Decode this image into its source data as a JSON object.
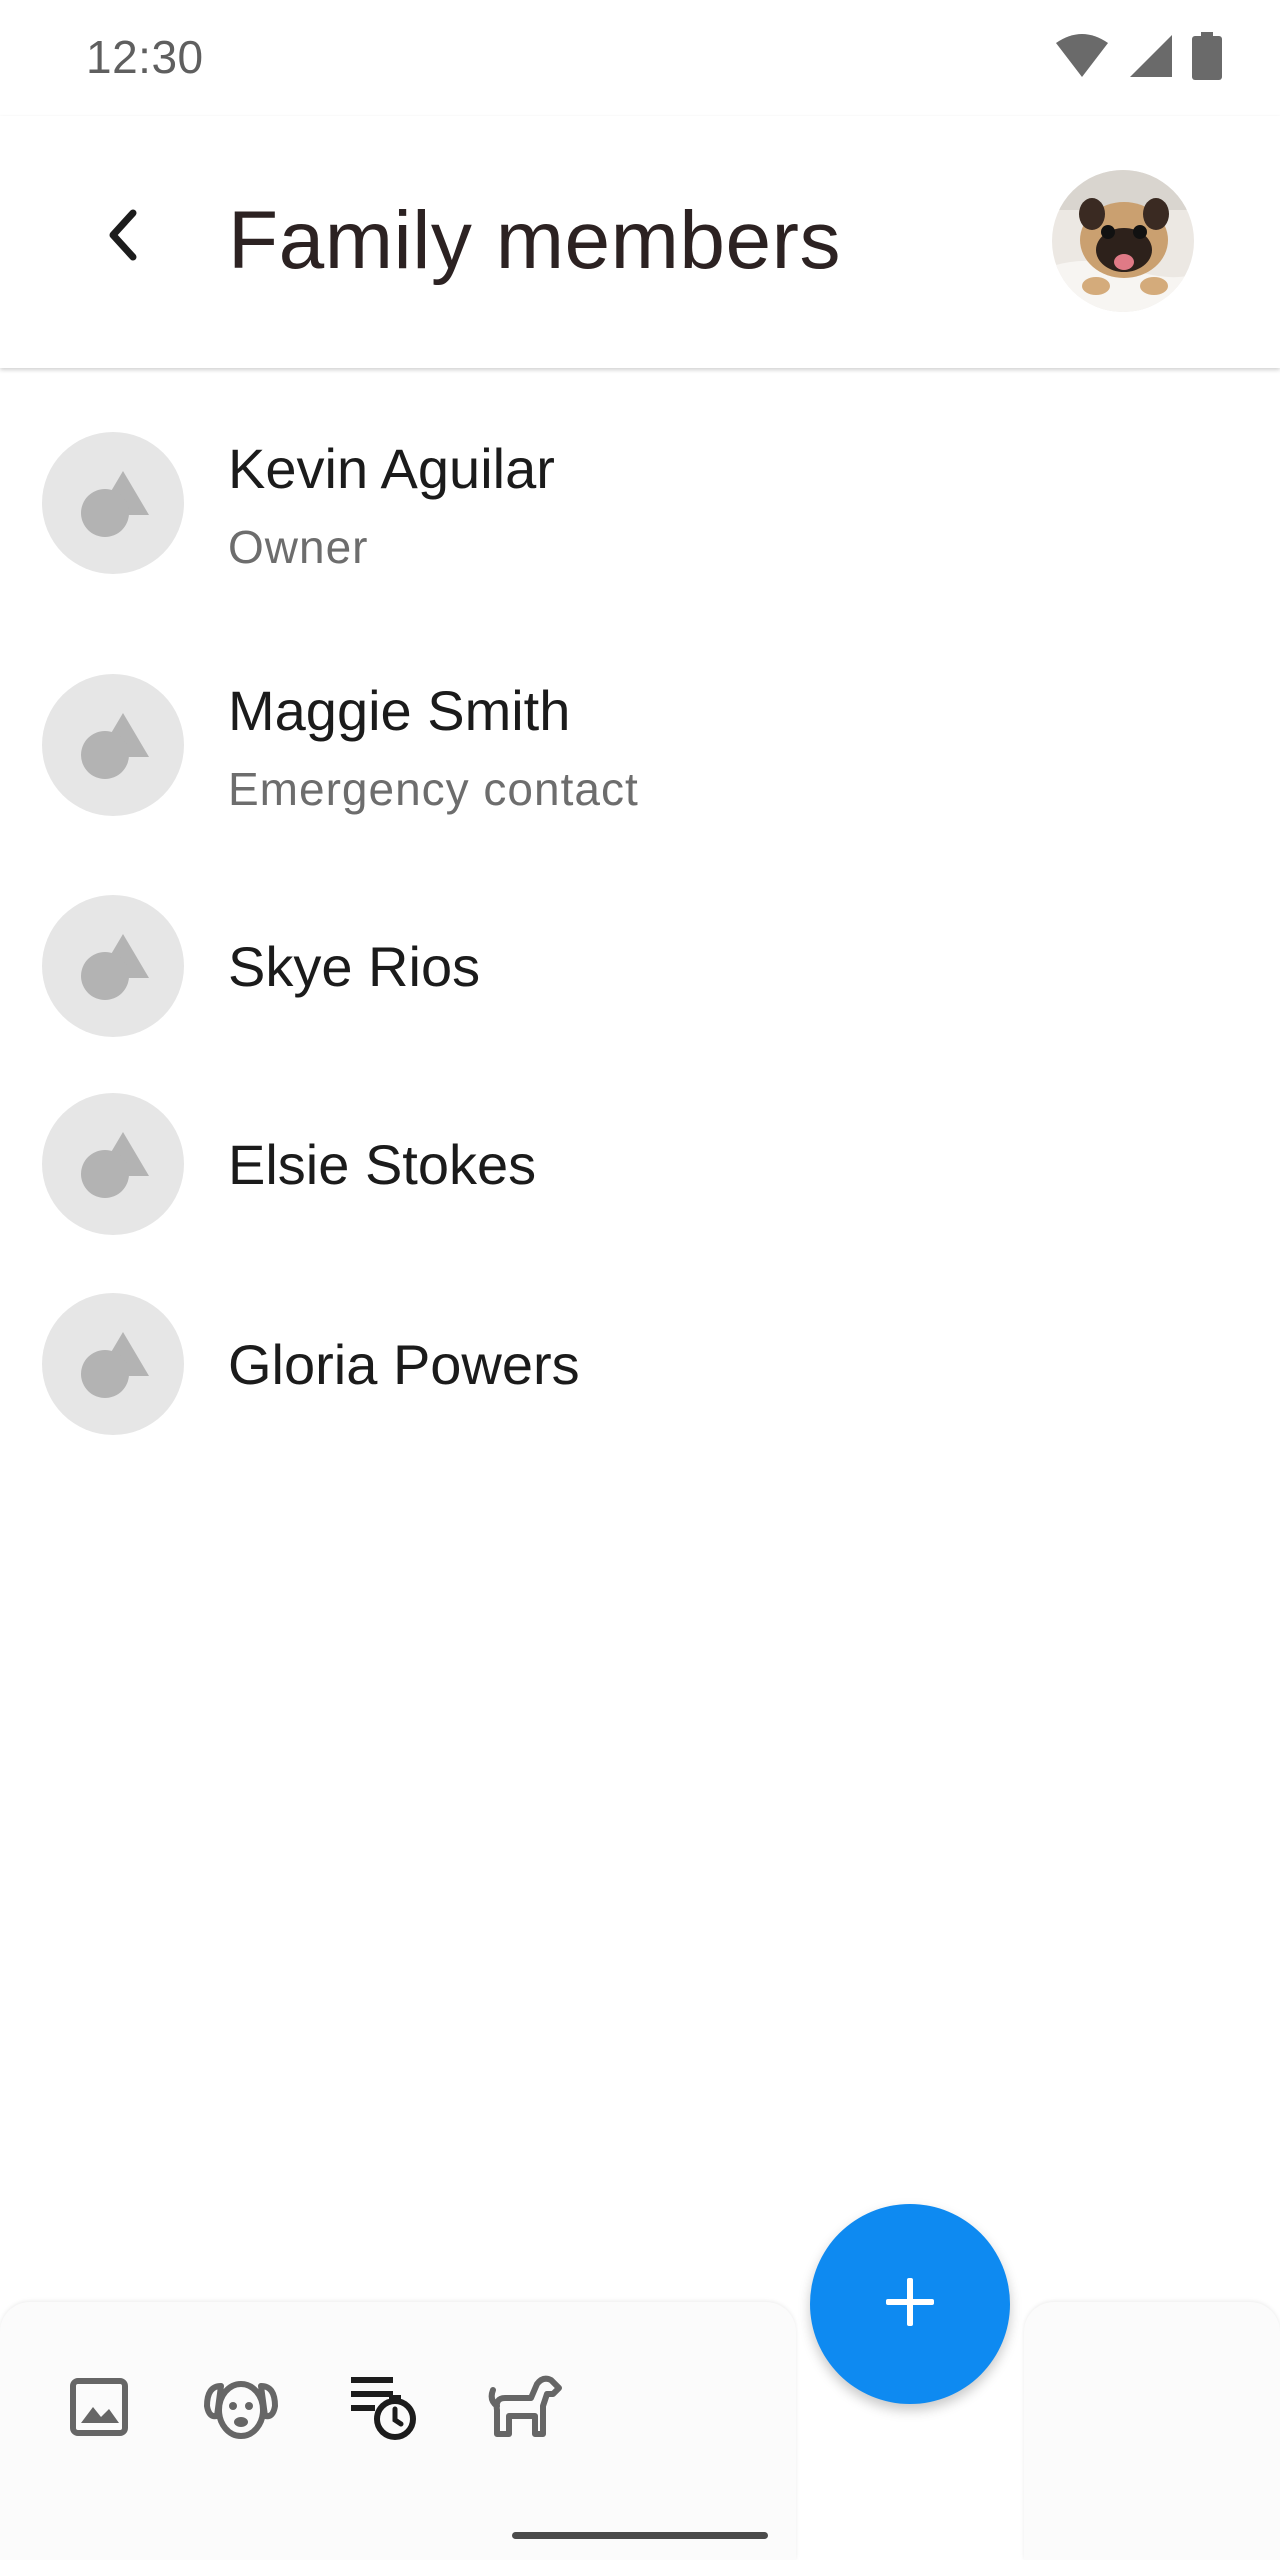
{
  "status_bar": {
    "time": "12:30",
    "icons": [
      "wifi-icon",
      "cellular-signal-icon",
      "battery-icon"
    ]
  },
  "top_bar": {
    "back_icon": "chevron-left-icon",
    "title": "Family members",
    "profile_avatar": "pug-photo"
  },
  "members": [
    {
      "name": "Kevin Aguilar",
      "role": "Owner"
    },
    {
      "name": "Maggie Smith",
      "role": "Emergency contact"
    },
    {
      "name": "Skye Rios",
      "role": ""
    },
    {
      "name": "Elsie Stokes",
      "role": ""
    },
    {
      "name": "Gloria Powers",
      "role": ""
    }
  ],
  "bottom_nav": {
    "items": [
      "image-icon",
      "dog-face-icon",
      "schedule-list-icon",
      "dog-icon"
    ],
    "active": "schedule-list-icon"
  },
  "fab": {
    "icon": "plus-icon"
  },
  "colors": {
    "accent": "#0e8af1",
    "title": "#2c2222",
    "avatar_placeholder": "#e6e6e6",
    "secondary_text": "#6d6d6d"
  }
}
